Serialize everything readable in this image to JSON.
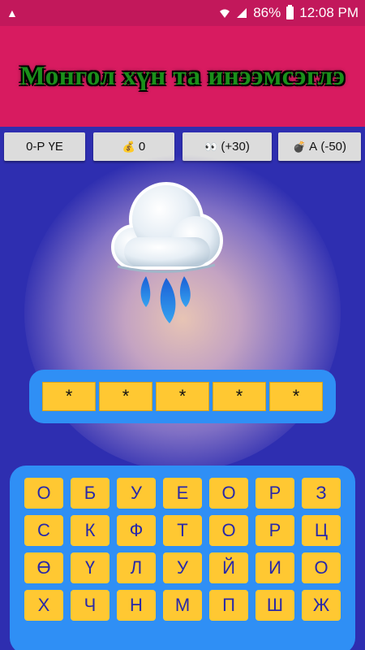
{
  "status_bar": {
    "alert_icon": "warning-triangle-icon",
    "battery_percent": "86%",
    "time": "12:08 PM"
  },
  "banner": {
    "title": "Монгол хүн та инээмсэглэ"
  },
  "toolbar": {
    "level_label": "0-Р ҮЕ",
    "coins_icon": "💰",
    "coins_value": "0",
    "hint_icon": "👀",
    "hint_label": "(+30)",
    "bomb_icon": "💣",
    "bomb_label": "А (-50)"
  },
  "puzzle": {
    "image_icon": "rain-cloud-icon",
    "answer_slots": [
      "*",
      "*",
      "*",
      "*",
      "*"
    ]
  },
  "keyboard": {
    "rows": [
      [
        "О",
        "Б",
        "У",
        "Е",
        "О",
        "Р",
        "З"
      ],
      [
        "С",
        "К",
        "Ф",
        "Т",
        "О",
        "Р",
        "Ц"
      ],
      [
        "Ө",
        "Ү",
        "Л",
        "У",
        "Й",
        "И",
        "О"
      ],
      [
        "Х",
        "Ч",
        "Н",
        "М",
        "П",
        "Ш",
        "Ж"
      ]
    ]
  },
  "colors": {
    "status_bar": "#c2185b",
    "banner": "#d81b60",
    "background": "#2e2eb0",
    "panel": "#2f8ff5",
    "key": "#ffc832",
    "key_text": "#2929a8"
  }
}
